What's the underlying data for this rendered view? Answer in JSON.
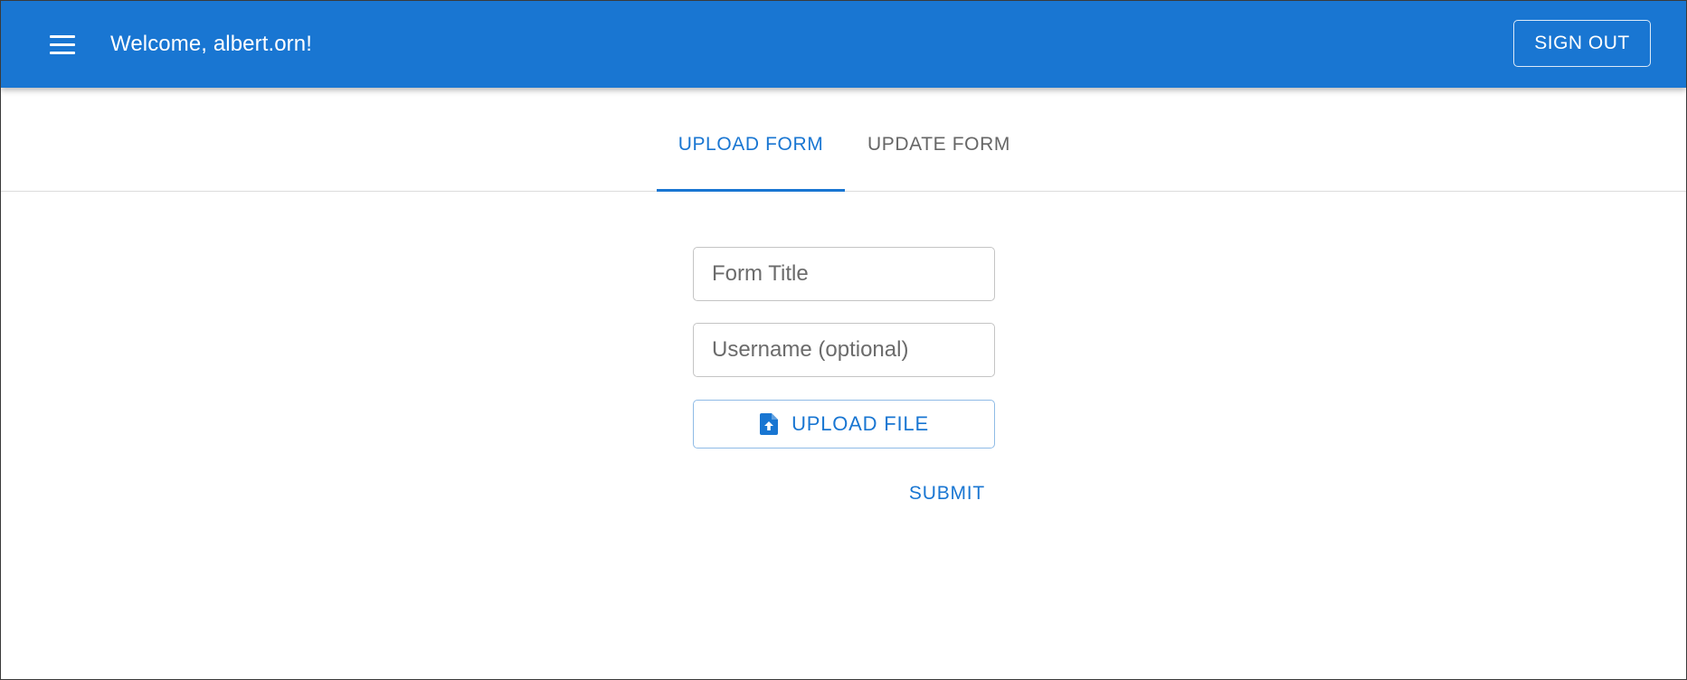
{
  "header": {
    "menu_icon": "hamburger-menu-icon",
    "welcome_text": "Welcome, albert.orn!",
    "sign_out_label": "SIGN OUT"
  },
  "tabs": [
    {
      "label": "UPLOAD FORM",
      "active": true
    },
    {
      "label": "UPDATE FORM",
      "active": false
    }
  ],
  "form": {
    "title_placeholder": "Form Title",
    "title_value": "",
    "username_placeholder": "Username (optional)",
    "username_value": "",
    "upload_icon": "file-upload-icon",
    "upload_label": "UPLOAD FILE",
    "submit_label": "SUBMIT"
  },
  "colors": {
    "primary": "#1976d2",
    "appbar_text": "#ffffff",
    "inactive_tab": "#666666",
    "field_border": "#c4c4c4"
  }
}
